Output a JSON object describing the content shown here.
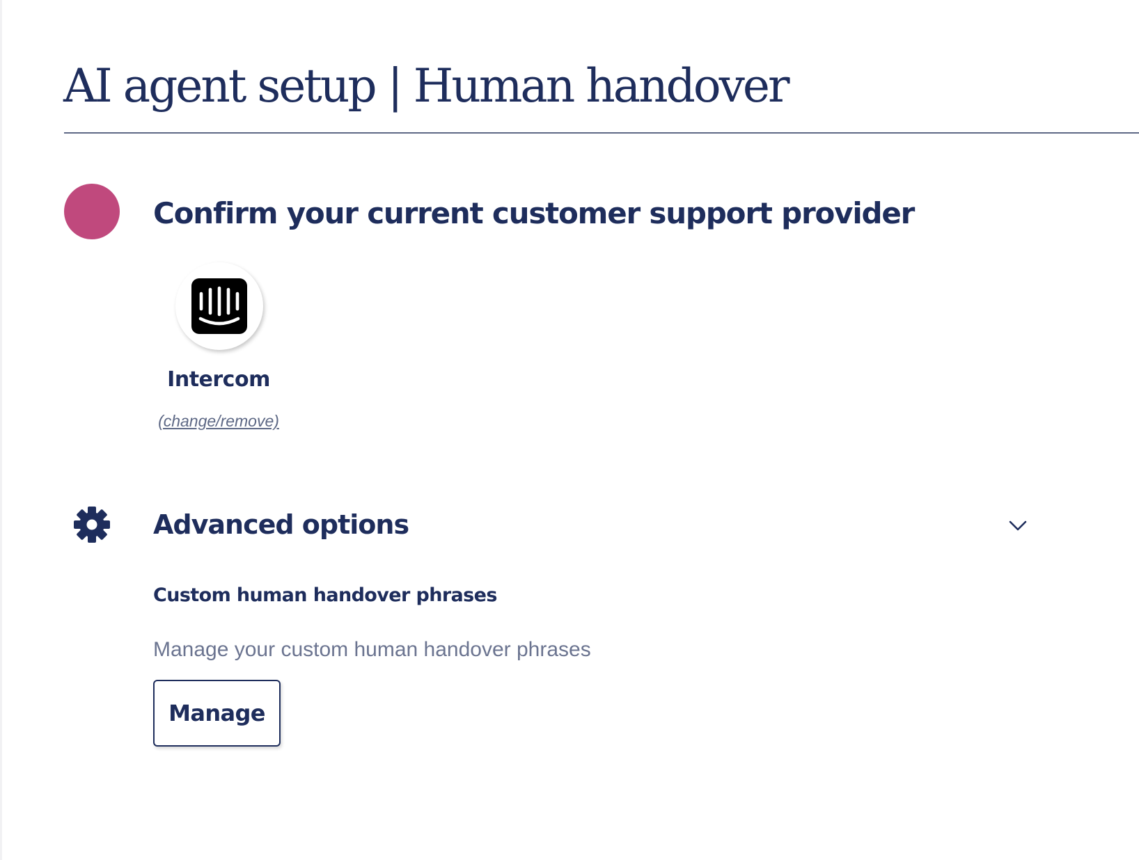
{
  "page": {
    "title": "AI agent setup | Human handover"
  },
  "provider_section": {
    "status_color": "#c0497d",
    "heading": "Confirm your current customer support provider",
    "provider": {
      "name": "Intercom",
      "icon": "intercom-logo-icon",
      "change_link": "(change/remove)"
    }
  },
  "advanced_section": {
    "icon": "gear-icon",
    "heading": "Advanced options",
    "expanded": true,
    "toggle_icon": "chevron-down-icon",
    "custom_phrases": {
      "heading": "Custom human handover phrases",
      "description": "Manage your custom human handover phrases",
      "button_label": "Manage"
    }
  },
  "colors": {
    "primary_text": "#1e2d5c",
    "muted_text": "#6b7490",
    "accent": "#c0497d"
  }
}
